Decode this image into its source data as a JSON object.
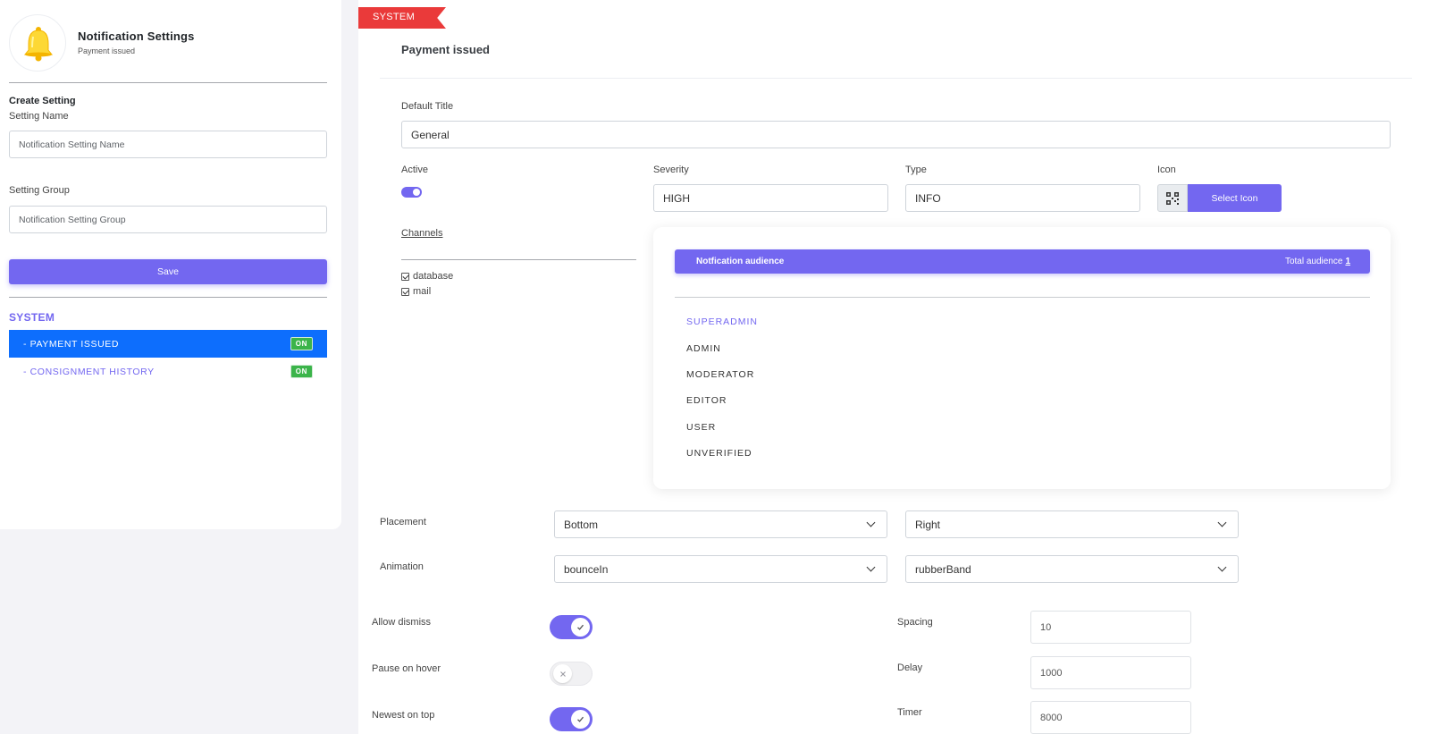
{
  "app": {
    "title": "Notification Settings",
    "subtitle": "Payment issued"
  },
  "create": {
    "heading": "Create Setting",
    "name_label": "Setting Name",
    "name_placeholder": "Notification Setting Name",
    "group_label": "Setting Group",
    "group_placeholder": "Notification Setting Group",
    "save_label": "Save"
  },
  "settings_list": {
    "group": "SYSTEM",
    "items": [
      {
        "label": "- PAYMENT ISSUED",
        "badge": "ON",
        "active": true
      },
      {
        "label": "- CONSIGNMENT HISTORY",
        "badge": "ON",
        "active": false
      }
    ]
  },
  "detail": {
    "ribbon": "SYSTEM",
    "title": "Payment issued",
    "default_title_label": "Default Title",
    "default_title_value": "General",
    "active_label": "Active",
    "active_on": true,
    "severity_label": "Severity",
    "severity_value": "HIGH",
    "type_label": "Type",
    "type_value": "INFO",
    "icon_label": "Icon",
    "select_icon_label": "Select Icon",
    "channels_label": "Channels",
    "channels": [
      {
        "label": "database",
        "checked": true
      },
      {
        "label": "mail",
        "checked": true
      }
    ]
  },
  "audience": {
    "title": "Notfication audience",
    "total_label": "Total audience",
    "total_value": "1",
    "roles": [
      {
        "label": "SUPERADMIN",
        "selected": true
      },
      {
        "label": "ADMIN",
        "selected": false
      },
      {
        "label": "MODERATOR",
        "selected": false
      },
      {
        "label": "EDITOR",
        "selected": false
      },
      {
        "label": "USER",
        "selected": false
      },
      {
        "label": "UNVERIFIED",
        "selected": false
      }
    ]
  },
  "display": {
    "placement_label": "Placement",
    "placement_vertical": "Bottom",
    "placement_horizontal": "Right",
    "animation_label": "Animation",
    "animation_in": "bounceIn",
    "animation_out": "rubberBand",
    "allow_dismiss_label": "Allow dismiss",
    "allow_dismiss": true,
    "pause_on_hover_label": "Pause on hover",
    "pause_on_hover": false,
    "newest_on_top_label": "Newest on top",
    "newest_on_top": true,
    "spacing_label": "Spacing",
    "spacing_value": "10",
    "delay_label": "Delay",
    "delay_value": "1000",
    "timer_label": "Timer",
    "timer_value": "8000"
  },
  "colors": {
    "accent": "#7367f0",
    "active_item": "#0d6efd",
    "ribbon": "#ea3a3a",
    "on_badge": "#3bb44a"
  },
  "icons": {
    "app": "bell-icon",
    "icon_picker": "qr-icon",
    "select_arrow": "chevron-down-icon",
    "toggle_on": "check-icon",
    "toggle_off": "x-icon"
  }
}
